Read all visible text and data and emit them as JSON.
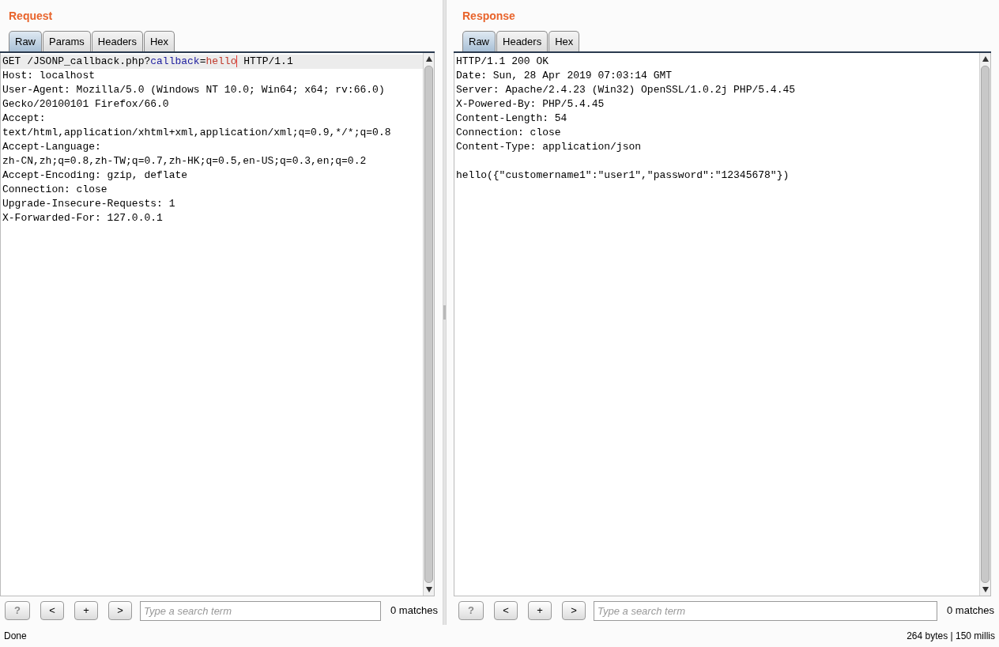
{
  "panes": [
    {
      "title": "Request",
      "tabs": [
        {
          "label": "Raw",
          "selected": true
        },
        {
          "label": "Params",
          "selected": false
        },
        {
          "label": "Headers",
          "selected": false
        },
        {
          "label": "Hex",
          "selected": false
        }
      ],
      "lines": [
        {
          "highlighted": true,
          "segments": [
            {
              "kind": "plain",
              "text": "GET /JSONP_callback.php?"
            },
            {
              "kind": "param_name",
              "text": "callback"
            },
            {
              "kind": "plain",
              "text": "="
            },
            {
              "kind": "param_value",
              "text": "hello",
              "caret": true
            },
            {
              "kind": "plain",
              "text": " HTTP/1.1"
            }
          ]
        },
        {
          "highlighted": false,
          "segments": [
            {
              "kind": "plain",
              "text": "Host: localhost"
            }
          ]
        },
        {
          "highlighted": false,
          "segments": [
            {
              "kind": "plain",
              "text": "User-Agent: Mozilla/5.0 (Windows NT 10.0; Win64; x64; rv:66.0)"
            }
          ]
        },
        {
          "highlighted": false,
          "segments": [
            {
              "kind": "plain",
              "text": "Gecko/20100101 Firefox/66.0"
            }
          ]
        },
        {
          "highlighted": false,
          "segments": [
            {
              "kind": "plain",
              "text": "Accept:"
            }
          ]
        },
        {
          "highlighted": false,
          "segments": [
            {
              "kind": "plain",
              "text": "text/html,application/xhtml+xml,application/xml;q=0.9,*/*;q=0.8"
            }
          ]
        },
        {
          "highlighted": false,
          "segments": [
            {
              "kind": "plain",
              "text": "Accept-Language:"
            }
          ]
        },
        {
          "highlighted": false,
          "segments": [
            {
              "kind": "plain",
              "text": "zh-CN,zh;q=0.8,zh-TW;q=0.7,zh-HK;q=0.5,en-US;q=0.3,en;q=0.2"
            }
          ]
        },
        {
          "highlighted": false,
          "segments": [
            {
              "kind": "plain",
              "text": "Accept-Encoding: gzip, deflate"
            }
          ]
        },
        {
          "highlighted": false,
          "segments": [
            {
              "kind": "plain",
              "text": "Connection: close"
            }
          ]
        },
        {
          "highlighted": false,
          "segments": [
            {
              "kind": "plain",
              "text": "Upgrade-Insecure-Requests: 1"
            }
          ]
        },
        {
          "highlighted": false,
          "segments": [
            {
              "kind": "plain",
              "text": "X-Forwarded-For: 127.0.0.1"
            }
          ]
        }
      ],
      "search": {
        "buttons": [
          "?",
          "<",
          "+",
          ">"
        ],
        "placeholder": "Type a search term",
        "matches": "0 matches"
      }
    },
    {
      "title": "Response",
      "tabs": [
        {
          "label": "Raw",
          "selected": true
        },
        {
          "label": "Headers",
          "selected": false
        },
        {
          "label": "Hex",
          "selected": false
        }
      ],
      "lines": [
        {
          "highlighted": false,
          "segments": [
            {
              "kind": "plain",
              "text": "HTTP/1.1 200 OK"
            }
          ]
        },
        {
          "highlighted": false,
          "segments": [
            {
              "kind": "plain",
              "text": "Date: Sun, 28 Apr 2019 07:03:14 GMT"
            }
          ]
        },
        {
          "highlighted": false,
          "segments": [
            {
              "kind": "plain",
              "text": "Server: Apache/2.4.23 (Win32) OpenSSL/1.0.2j PHP/5.4.45"
            }
          ]
        },
        {
          "highlighted": false,
          "segments": [
            {
              "kind": "plain",
              "text": "X-Powered-By: PHP/5.4.45"
            }
          ]
        },
        {
          "highlighted": false,
          "segments": [
            {
              "kind": "plain",
              "text": "Content-Length: 54"
            }
          ]
        },
        {
          "highlighted": false,
          "segments": [
            {
              "kind": "plain",
              "text": "Connection: close"
            }
          ]
        },
        {
          "highlighted": false,
          "segments": [
            {
              "kind": "plain",
              "text": "Content-Type: application/json"
            }
          ]
        },
        {
          "highlighted": false
        },
        {
          "highlighted": false,
          "segments": [
            {
              "kind": "plain",
              "text": "hello({\"customername1\":\"user1\",\"password\":\"12345678\"})"
            }
          ]
        }
      ],
      "search": {
        "buttons": [
          "?",
          "<",
          "+",
          ">"
        ],
        "placeholder": "Type a search term",
        "matches": "0 matches"
      }
    }
  ],
  "status_bar": {
    "left": "Done",
    "right": "264 bytes | 150 millis"
  }
}
